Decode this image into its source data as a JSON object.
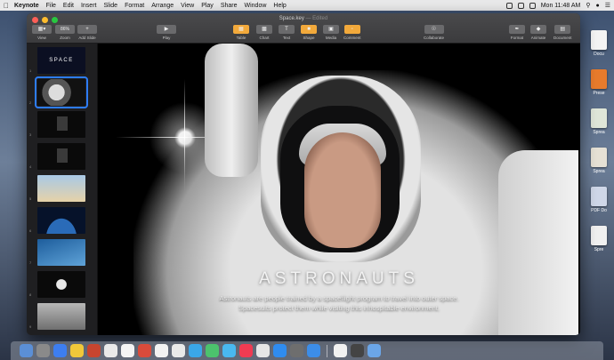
{
  "menubar": {
    "app": "Keynote",
    "items": [
      "File",
      "Edit",
      "Insert",
      "Slide",
      "Format",
      "Arrange",
      "View",
      "Play",
      "Share",
      "Window",
      "Help"
    ],
    "clock": "Mon 11:48 AM"
  },
  "window": {
    "title": "Space.key",
    "edited": "— Edited"
  },
  "toolbar": {
    "view": "View",
    "zoom_value": "86%",
    "zoom": "Zoom",
    "add_slide": "Add Slide",
    "play": "Play",
    "table": "Table",
    "chart": "Chart",
    "text": "Text",
    "shape": "Shape",
    "media": "Media",
    "comment": "Comment",
    "collaborate": "Collaborate",
    "format": "Format",
    "animate": "Animate",
    "document": "Document"
  },
  "navigator": {
    "slides": [
      {
        "num": "1",
        "kind": "space",
        "text": "SPACE"
      },
      {
        "num": "2",
        "kind": "astro"
      },
      {
        "num": "3",
        "kind": "dark"
      },
      {
        "num": "4",
        "kind": "dark"
      },
      {
        "num": "5",
        "kind": "rocket"
      },
      {
        "num": "6",
        "kind": "earth"
      },
      {
        "num": "7",
        "kind": "blue"
      },
      {
        "num": "8",
        "kind": "walk"
      },
      {
        "num": "9",
        "kind": "moon"
      }
    ],
    "selected": "2"
  },
  "slide": {
    "title": "ASTRONAUTS",
    "body_line1": "Astronauts are people trained by a spaceflight program to travel into outer space.",
    "body_line2": "Spacesuits protect them while visiting this inhospitable environment."
  },
  "desktop_icons": [
    "Docu",
    "Prese",
    "Sprea",
    "Sprea",
    "PDF Do",
    "Spre"
  ],
  "dock_colors": [
    "#5b8fd6",
    "#8a8a8a",
    "#3d7ef0",
    "#f0c83a",
    "#c7452f",
    "#e9e9e9",
    "#f4f4f4",
    "#d94b3b",
    "#f2f2f2",
    "#e9e9e9",
    "#3aa7e8",
    "#4cc26d",
    "#49b8f0",
    "#ef3b52",
    "#e6e6e6",
    "#2f8cf0",
    "#6e6e6e",
    "#3c8de8",
    "#f1f1f1",
    "#444444",
    "#6ba6e8"
  ]
}
